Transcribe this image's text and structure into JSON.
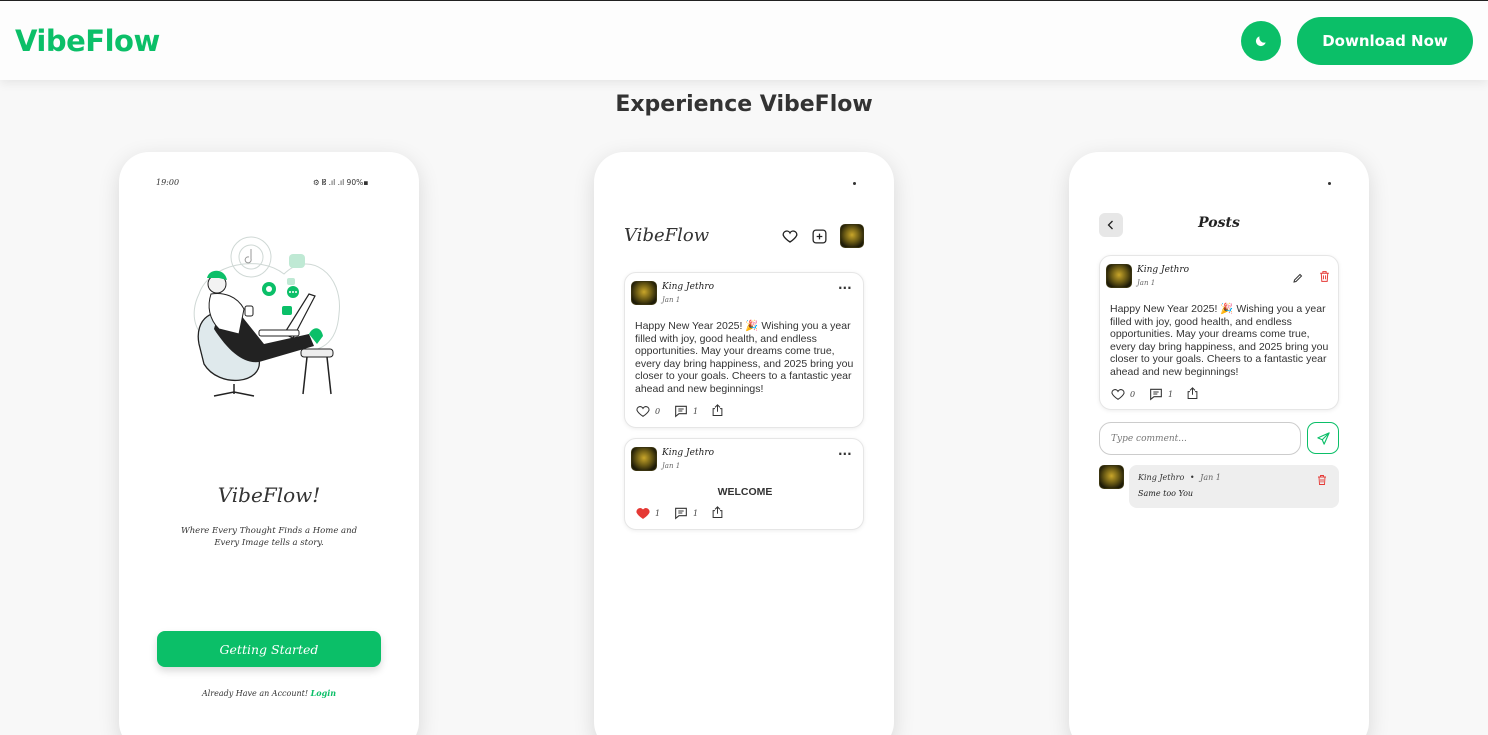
{
  "header": {
    "logo": "VibeFlow",
    "download_label": "Download Now",
    "accent_color": "#0bbf68",
    "theme_icon": "moon-icon"
  },
  "section_title": "Experience VibeFlow",
  "phone1": {
    "status_time": "19:00",
    "status_icons": "⚙ 𝄡 .ıl .ıl 90%▪",
    "title": "VibeFlow!",
    "tagline_line1": "Where Every Thought Finds a Home and",
    "tagline_line2": "Every Image tells a story.",
    "start_button": "Getting Started",
    "login_prompt": "Already Have an Account!",
    "login_link": "Login"
  },
  "phone2": {
    "app_title": "VibeFlow",
    "posts": [
      {
        "user": "King Jethro",
        "date": "Jan 1",
        "text": "Happy New Year 2025! 🎉 Wishing you a year filled with joy, good health, and endless opportunities. May your dreams come true, every day bring happiness, and 2025 bring you closer to your goals. Cheers to a fantastic year ahead and new beginnings!",
        "likes": "0",
        "comments": "1"
      },
      {
        "user": "King Jethro",
        "date": "Jan 1",
        "text": "WELCOME",
        "likes": "1",
        "comments": "1",
        "liked": true
      }
    ]
  },
  "phone3": {
    "title": "Posts",
    "post": {
      "user": "King Jethro",
      "date": "Jan 1",
      "text": "Happy New Year 2025! 🎉 Wishing you a year filled with joy, good health, and endless opportunities. May your dreams come true, every day bring happiness, and 2025 bring you closer to your goals. Cheers to a fantastic year ahead and new beginnings!",
      "likes": "0",
      "comments": "1"
    },
    "comment_placeholder": "Type comment...",
    "comment": {
      "user": "King Jethro",
      "separator": "•",
      "date": "Jan 1",
      "text": "Same too You"
    }
  }
}
